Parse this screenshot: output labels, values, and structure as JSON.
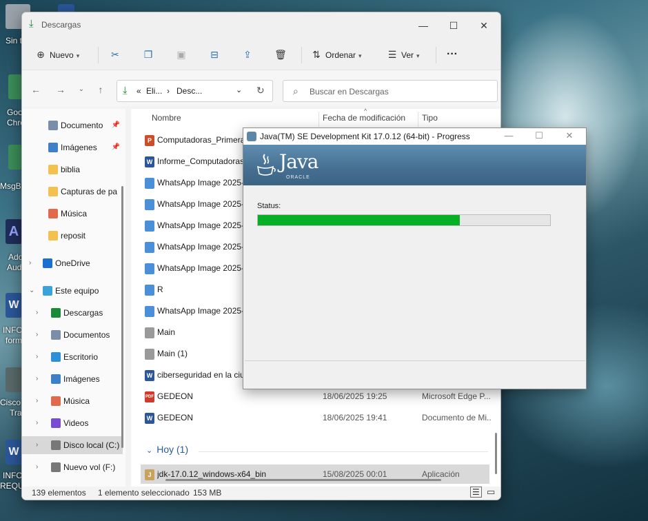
{
  "desktop": {
    "labels": [
      "Sin t",
      "Goo",
      "Chro",
      "MsgBo",
      "Ado",
      "Aud",
      "INFO",
      "form",
      "Cisco P",
      "Tra",
      "INFO",
      "REQUE"
    ]
  },
  "explorer": {
    "title": "Descargas",
    "toolbar": {
      "new_label": "Nuevo",
      "sort_label": "Ordenar",
      "view_label": "Ver",
      "more_label": "···"
    },
    "address": {
      "part1": "Eli...",
      "part2": "Desc...",
      "sep1": "«",
      "sep2": "›"
    },
    "search_placeholder": "Buscar en Descargas",
    "sidebar": [
      {
        "label": "Documento",
        "icon": "document-icon",
        "pinned": true
      },
      {
        "label": "Imágenes",
        "icon": "images-icon",
        "pinned": true
      },
      {
        "label": "biblia",
        "icon": "folder-icon"
      },
      {
        "label": "Capturas de pa",
        "icon": "folder-icon"
      },
      {
        "label": "Música",
        "icon": "music-icon"
      },
      {
        "label": "reposit",
        "icon": "folder-icon"
      },
      {
        "label": "OneDrive",
        "icon": "cloud-icon"
      },
      {
        "label": "Este equipo",
        "icon": "computer-icon"
      },
      {
        "label": "Descargas",
        "icon": "download-icon"
      },
      {
        "label": "Documentos",
        "icon": "document-icon"
      },
      {
        "label": "Escritorio",
        "icon": "desktop-icon"
      },
      {
        "label": "Imágenes",
        "icon": "images-icon"
      },
      {
        "label": "Música",
        "icon": "music-icon"
      },
      {
        "label": "Videos",
        "icon": "video-icon"
      },
      {
        "label": "Disco local (C:)",
        "icon": "drive-icon"
      },
      {
        "label": "Nuevo vol (F:)",
        "icon": "drive-icon"
      }
    ],
    "columns": {
      "name": "Nombre",
      "date": "Fecha de modificación",
      "type": "Tipo"
    },
    "files": [
      {
        "name": "Computadoras_Primera",
        "date": "",
        "type": "",
        "kind": "ppt"
      },
      {
        "name": "Informe_Computadoras",
        "date": "",
        "type": "",
        "kind": "word"
      },
      {
        "name": "WhatsApp Image 2025-0",
        "date": "",
        "type": "",
        "kind": "image"
      },
      {
        "name": "WhatsApp Image 2025-0",
        "date": "",
        "type": "",
        "kind": "image"
      },
      {
        "name": "WhatsApp Image 2025-0",
        "date": "",
        "type": "",
        "kind": "image"
      },
      {
        "name": "WhatsApp Image 2025-0",
        "date": "",
        "type": "",
        "kind": "image"
      },
      {
        "name": "WhatsApp Image 2025-0",
        "date": "",
        "type": "",
        "kind": "image"
      },
      {
        "name": "R",
        "date": "",
        "type": "",
        "kind": "image"
      },
      {
        "name": "WhatsApp Image 2025-0",
        "date": "",
        "type": "",
        "kind": "image"
      },
      {
        "name": "Main",
        "date": "",
        "type": "",
        "kind": "text"
      },
      {
        "name": "Main (1)",
        "date": "",
        "type": "",
        "kind": "text"
      },
      {
        "name": "ciberseguridad en la ciu",
        "date": "",
        "type": "",
        "kind": "word"
      },
      {
        "name": "GEDEON",
        "date": "18/06/2025 19:25",
        "type": "Microsoft Edge P...",
        "kind": "pdf"
      },
      {
        "name": "GEDEON",
        "date": "18/06/2025 19:41",
        "type": "Documento de Mi...",
        "kind": "word"
      }
    ],
    "group_today": "Hoy (1)",
    "today_file": {
      "name": "jdk-17.0.12_windows-x64_bin",
      "date": "15/08/2025 00:01",
      "type": "Aplicación"
    },
    "status": {
      "count": "139 elementos",
      "selected": "1 elemento seleccionado",
      "size": "153 MB"
    }
  },
  "java_dialog": {
    "title": "Java(TM) SE Development Kit 17.0.12 (64-bit) - Progress",
    "brand": "Java",
    "brand_sub": "ORACLE",
    "status_label": "Status:",
    "progress_fraction": 0.69,
    "progress_color": "#06b025"
  }
}
